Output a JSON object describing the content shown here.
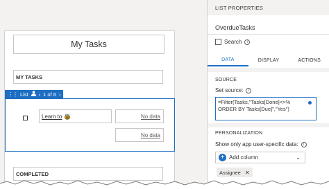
{
  "canvas": {
    "title": "My Tasks",
    "my_tasks_header": "MY TASKS",
    "list_toolbar": {
      "label": "List",
      "counter": "1 of 6"
    },
    "row": {
      "task_text": "Learn to",
      "no_data_1": "No data",
      "no_data_2": "No data"
    },
    "completed_header": "COMPLETED"
  },
  "panel": {
    "header": "LIST PROPERTIES",
    "name": "OverdueTasks",
    "search_label": "Search",
    "tabs": [
      "DATA",
      "DISPLAY",
      "ACTIONS"
    ],
    "source_title": "SOURCE",
    "set_source_label": "Set source:",
    "formula_lines": [
      "=Filter(Tasks,\"Tasks[Done]<>%",
      "ORDER BY Tasks[Due]\",\"Yes\")"
    ],
    "personalization_title": "PERSONALIZATION",
    "show_only_label": "Show only app user-specific data:",
    "add_column_label": "Add column",
    "chip_label": "Assignee"
  },
  "colors": {
    "accent": "#1e6fc2",
    "canvas_bg": "#f3f2f1",
    "border": "#c8c6c4"
  },
  "icons": [
    "drag-dots-icon",
    "person-icon",
    "chevron-left-icon",
    "chevron-right-icon",
    "info-icon",
    "plus-icon",
    "chevron-down-icon",
    "close-icon",
    "bee-icon"
  ]
}
